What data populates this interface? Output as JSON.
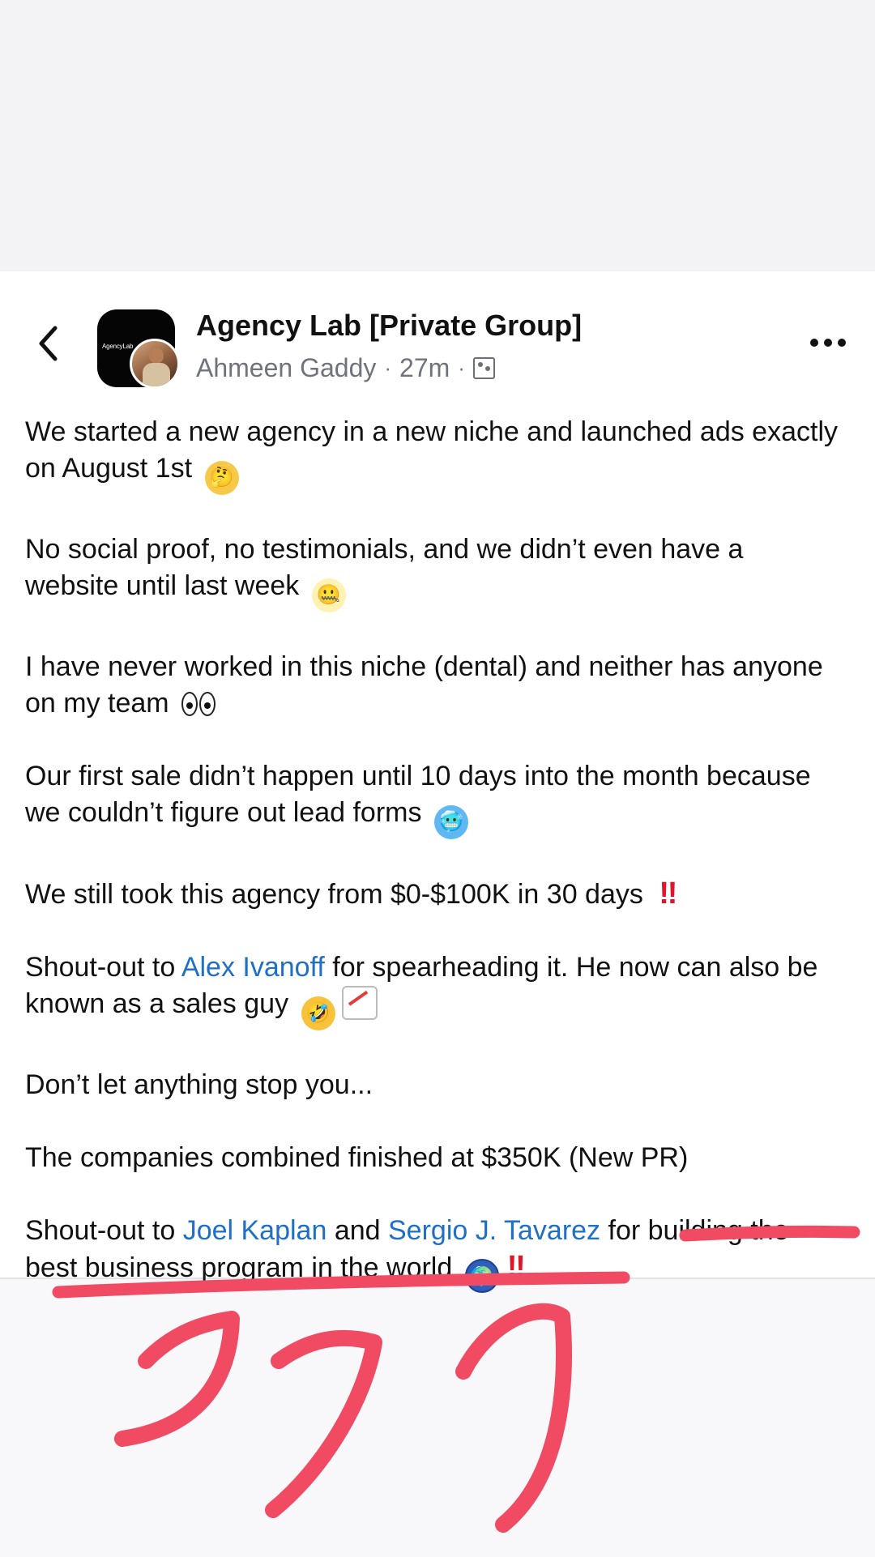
{
  "header": {
    "group_name": "Agency Lab [Private Group]",
    "author": "Ahmeen Gaddy",
    "time": "27m",
    "avatar_text": "AgencyLab",
    "back_icon": "chevron-left-icon",
    "menu_icon": "more-horizontal-icon",
    "privacy_icon": "group-privacy-icon"
  },
  "post": {
    "p1": "We started a new agency in a new niche and launched ads exactly on August 1st",
    "p2": "No social proof, no testimonials, and we didn’t even have a website until last week",
    "p3": "I have never worked in this niche (dental) and neither has anyone on my team",
    "p4": "Our first sale didn’t happen until 10 days into the month because we couldn’t figure out lead forms",
    "p5": "We still took this agency from $0-$100K in 30 days",
    "p6a": "Shout-out to ",
    "p6_link": "Alex Ivanoff",
    "p6b": " for spearheading it. He now can also be known as a sales guy",
    "p7": "Don’t let anything stop you...",
    "p8": "The companies combined finished at $350K (New PR)",
    "p9a": "Shout-out to ",
    "p9_link1": "Joel Kaplan",
    "p9b": " and ",
    "p9_link2": "Sergio J. Tavarez",
    "p9c": " for building the best business program in the world",
    "bang": "‼"
  },
  "colors": {
    "link": "#1f6fc6",
    "annotation": "#f04b63",
    "muted_text": "#70737b"
  }
}
